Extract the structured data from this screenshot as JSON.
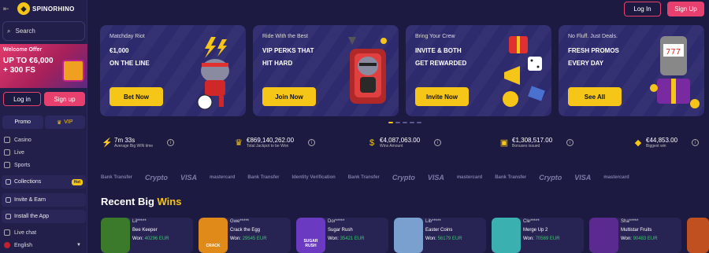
{
  "logo": {
    "text": "SPINORHINO"
  },
  "search": {
    "label": "Search"
  },
  "welcome": {
    "title": "Welcome Offer",
    "line1": "UP TO €6,000",
    "line2": "+ 300 FS"
  },
  "auth": {
    "login": "Log in",
    "signup": "Sign up"
  },
  "top_auth": {
    "login": "Log In",
    "signup": "Sign Up"
  },
  "tabs": {
    "promo": "Promo",
    "vip": "VIP"
  },
  "nav": {
    "casino": "Casino",
    "live": "Live",
    "sports": "Sports"
  },
  "collections": {
    "label": "Collections",
    "badge": "Hot"
  },
  "invite": {
    "label": "Invite & Earn"
  },
  "install": {
    "label": "Install the App"
  },
  "livechat": {
    "label": "Live chat"
  },
  "language": {
    "label": "English"
  },
  "banners": [
    {
      "sub": "Matchday Riot",
      "line1": "€1,000",
      "line2": "ON THE LINE",
      "cta": "Bet Now"
    },
    {
      "sub": "Ride With the Best",
      "line1": "VIP PERKS THAT",
      "line2": "HIT HARD",
      "cta": "Join Now"
    },
    {
      "sub": "Bring Your Crew",
      "line1": "INVITE & BOTH",
      "line2": "GET REWARDED",
      "cta": "Invite Now"
    },
    {
      "sub": "No Fluff. Just Deals.",
      "line1": "FRESH PROMOS",
      "line2": "EVERY DAY",
      "cta": "See All"
    }
  ],
  "stats": [
    {
      "value": "7m 33s",
      "label": "Average Big WIN time",
      "icon": "lightning-icon"
    },
    {
      "value": "€869,140,262.00",
      "label": "Total Jackpot to be Won",
      "icon": "crown-icon"
    },
    {
      "value": "€4,087,063.00",
      "label": "Wins Amount",
      "icon": "money-bag-icon"
    },
    {
      "value": "€1,308,517.00",
      "label": "Bonuses issued",
      "icon": "gift-icon"
    },
    {
      "value": "€44,853.00",
      "label": "Biggest win",
      "icon": "diamond-icon"
    }
  ],
  "payments": [
    "Bank Transfer",
    "Crypto",
    "VISA",
    "mastercard",
    "Bank Transfer",
    "Identity Verification",
    "Bank Transfer",
    "Crypto",
    "VISA",
    "mastercard",
    "Bank Transfer",
    "Crypto",
    "VISA",
    "mastercard"
  ],
  "recent": {
    "title_part1": "Recent Big",
    "title_part2": "Wins"
  },
  "wins": [
    {
      "user": "Lil*****",
      "game": "Bee Keeper",
      "won_label": "Won:",
      "amount": "40296 EUR",
      "thumb": "",
      "color": "#3a7a2a"
    },
    {
      "user": "Gwe*****",
      "game": "Crack the Egg",
      "won_label": "Won:",
      "amount": "29545 EUR",
      "thumb": "CRACK",
      "color": "#e08a1a"
    },
    {
      "user": "Dor*****",
      "game": "Sugar Rush",
      "won_label": "Won:",
      "amount": "35421 EUR",
      "thumb": "SUGAR RUSH",
      "color": "#6a3ac0"
    },
    {
      "user": "Lib*****",
      "game": "Easter Coins",
      "won_label": "Won:",
      "amount": "56179 EUR",
      "thumb": "",
      "color": "#7aa0d0"
    },
    {
      "user": "Cle*****",
      "game": "Merge Up 2",
      "won_label": "Won:",
      "amount": "70569 EUR",
      "thumb": "",
      "color": "#3ab0b0"
    },
    {
      "user": "Sha*****",
      "game": "Multistar Fruits",
      "won_label": "Won:",
      "amount": "90483 EUR",
      "thumb": "",
      "color": "#5a2a90"
    }
  ]
}
